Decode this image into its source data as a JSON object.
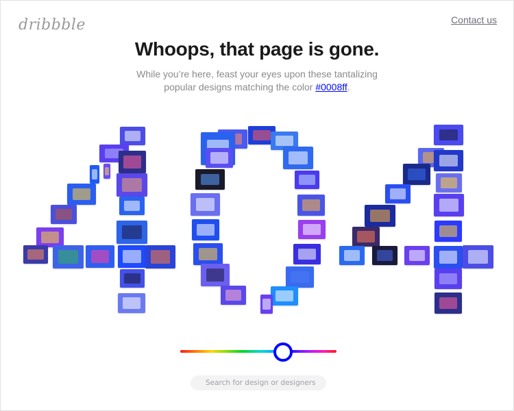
{
  "brand": {
    "logo_text": "dribbble"
  },
  "header": {
    "contact_label": "Contact us"
  },
  "main": {
    "title": "Whoops, that page is gone.",
    "subtitle_line1": "While you’re here, feast your eyes upon these tantalizing",
    "subtitle_line2_prefix": "popular designs matching the color ",
    "color_link": "#0008ff",
    "subtitle_suffix": "."
  },
  "mosaic": {
    "digits": "404",
    "tiles": [
      {
        "bg": "#4b4de6",
        "ph": "#ffffff"
      },
      {
        "bg": "#5a3ff0",
        "ph": "#b9b4ff"
      },
      {
        "bg": "#2b2f8a",
        "ph": "#ff5fa0"
      },
      {
        "bg": "#6c4df2",
        "ph": "#ffd74a"
      },
      {
        "bg": "#1f5cf5",
        "ph": "#ffffff"
      },
      {
        "bg": "#5a48e8",
        "ph": "#f0a070"
      },
      {
        "bg": "#2a5ef0",
        "ph": "#ffcf3a"
      },
      {
        "bg": "#2a63f2",
        "ph": "#ffffff"
      },
      {
        "bg": "#4a4fdc",
        "ph": "#c0563a"
      },
      {
        "bg": "#2d64e8",
        "ph": "#1b1b4a"
      },
      {
        "bg": "#7a3ff0",
        "ph": "#ffcf3a"
      },
      {
        "bg": "#3a3aa8",
        "ph": "#ff8a5a"
      },
      {
        "bg": "#3f63e8",
        "ph": "#2fb35a"
      },
      {
        "bg": "#2f5ef0",
        "ph": "#ff3fa0"
      },
      {
        "bg": "#1e4bff",
        "ph": "#ffffff"
      },
      {
        "bg": "#2a44d8",
        "ph": "#ff7a3a"
      },
      {
        "bg": "#4450e8",
        "ph": "#1a1a3a"
      },
      {
        "bg": "#6a7af0",
        "ph": "#ffffff"
      },
      {
        "bg": "#4a5af0",
        "ph": "#ff8a6a"
      },
      {
        "bg": "#2a62f0",
        "ph": "#ffffff"
      },
      {
        "bg": "#1e3fd8",
        "ph": "#ff5a5a"
      },
      {
        "bg": "#3a7af0",
        "ph": "#ffffff"
      },
      {
        "bg": "#2f6af0",
        "ph": "#ffffff"
      },
      {
        "bg": "#5b4ef2",
        "ph": "#ffffff"
      },
      {
        "bg": "#1a1a2a",
        "ph": "#5aa0ff"
      },
      {
        "bg": "#4a3af2",
        "ph": "#c4dcff"
      },
      {
        "bg": "#6a6ff0",
        "ph": "#ffffff"
      },
      {
        "bg": "#4a55e8",
        "ph": "#ffb43a"
      },
      {
        "bg": "#1f4ff0",
        "ph": "#ffffff"
      },
      {
        "bg": "#9a3ff0",
        "ph": "#ffffff"
      },
      {
        "bg": "#2a4ff0",
        "ph": "#ffcf3a"
      },
      {
        "bg": "#3a2fe0",
        "ph": "#ffffff"
      },
      {
        "bg": "#6a5ff0",
        "ph": "#1a1a3a"
      },
      {
        "bg": "#3a6af0",
        "ph": "#4a7af0"
      },
      {
        "bg": "#5a48e8",
        "ph": "#ffb0d0"
      },
      {
        "bg": "#1e8fff",
        "ph": "#ffffff"
      },
      {
        "bg": "#6a3ff0",
        "ph": "#ffffff"
      },
      {
        "bg": "#4a4af0",
        "ph": "#1a1a3a"
      },
      {
        "bg": "#5a68f0",
        "ph": "#ffb43a"
      },
      {
        "bg": "#2238c8",
        "ph": "#ffffff"
      },
      {
        "bg": "#1a2a8a",
        "ph": "#3a6af0"
      },
      {
        "bg": "#6a6ff0",
        "ph": "#ffcf3a"
      },
      {
        "bg": "#2a4ff0",
        "ph": "#ffffff"
      },
      {
        "bg": "#5a3ff0",
        "ph": "#ffffff"
      },
      {
        "bg": "#1a2aa0",
        "ph": "#ffb43a"
      },
      {
        "bg": "#2a3aff",
        "ph": "#ffcf3a"
      },
      {
        "bg": "#3a2a6a",
        "ph": "#ff7a5a"
      },
      {
        "bg": "#2a6af0",
        "ph": "#ffffff"
      },
      {
        "bg": "#1a1a3a",
        "ph": "#4a6af0"
      },
      {
        "bg": "#6a3ff0",
        "ph": "#ffffff"
      },
      {
        "bg": "#2a4ff0",
        "ph": "#ffffff"
      }
    ]
  },
  "color_slider": {
    "selected_color": "#0008ff",
    "hue_position": 0.66
  },
  "search": {
    "placeholder": "Search for design or designers",
    "value": ""
  }
}
